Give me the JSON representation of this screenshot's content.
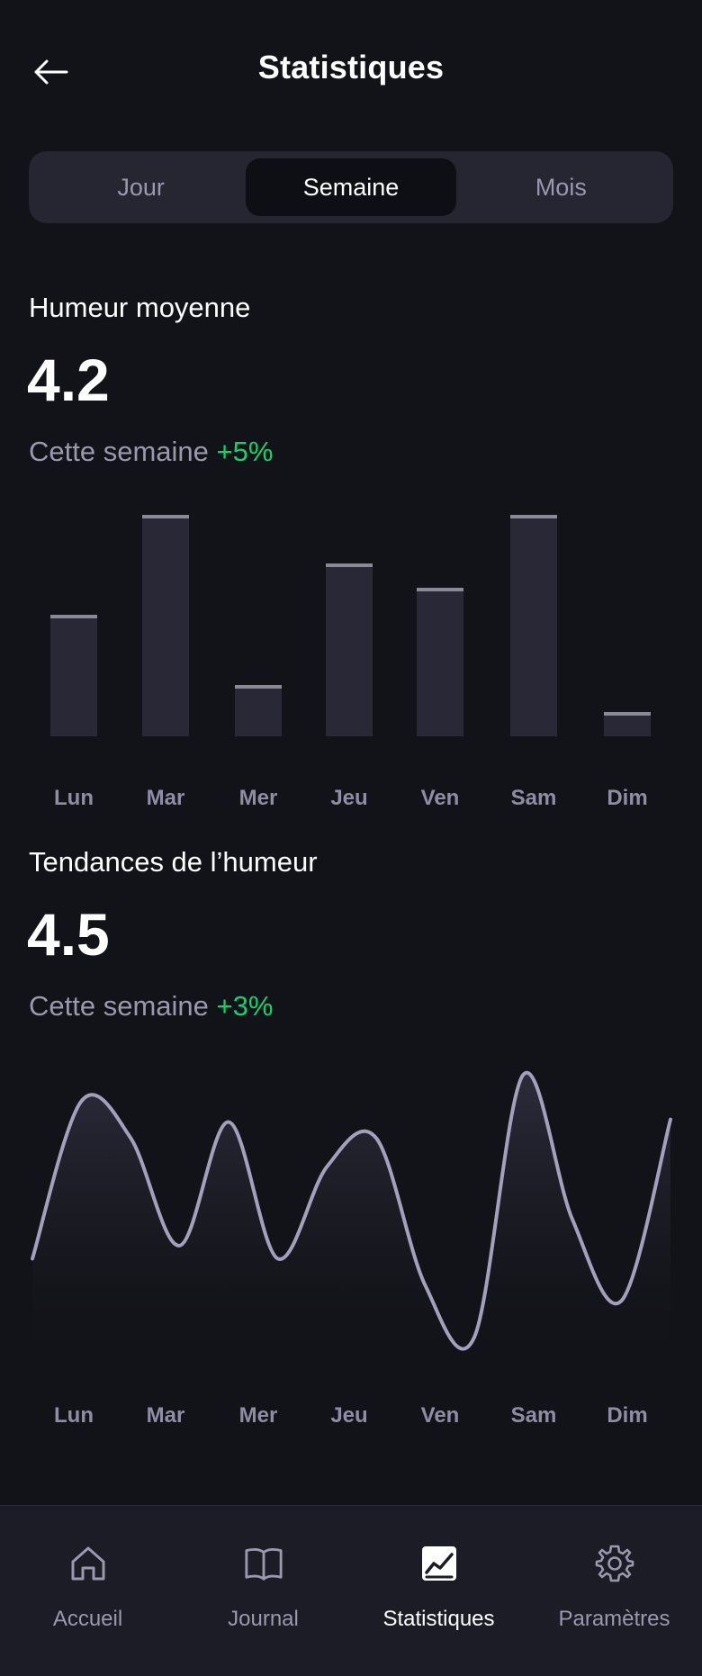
{
  "header": {
    "title": "Statistiques"
  },
  "tabs": [
    {
      "label": "Jour"
    },
    {
      "label": "Semaine"
    },
    {
      "label": "Mois"
    }
  ],
  "mood_average": {
    "title": "Humeur moyenne",
    "value": "4.2",
    "period": "Cette semaine",
    "delta": "+5%"
  },
  "mood_trend": {
    "title": "Tendances de l’humeur",
    "value": "4.5",
    "period": "Cette semaine",
    "delta": "+3%"
  },
  "colors": {
    "background": "#121318",
    "bar": "#282836",
    "bar_cap": "#8a8a96",
    "line": "#a39fbc",
    "positive": "#12d26a",
    "muted": "#9a98ae"
  },
  "chart_data": [
    {
      "type": "bar",
      "categories": [
        "Lun",
        "Mar",
        "Mer",
        "Jeu",
        "Ven",
        "Sam",
        "Dim"
      ],
      "values": [
        4.5,
        8.2,
        1.9,
        6.4,
        5.5,
        8.2,
        0.9
      ],
      "ylim": [
        0,
        8.2
      ],
      "grid": false
    },
    {
      "type": "line",
      "categories": [
        "Lun",
        "Mar",
        "Mer",
        "Jeu",
        "Ven",
        "Sam",
        "Dim"
      ],
      "area": true,
      "grid": false,
      "x": [
        0,
        0.5,
        1,
        1.5,
        2,
        2.5,
        3,
        3.5,
        4,
        4.5,
        5,
        5.5,
        6,
        6.5
      ],
      "values": [
        3.0,
        9.0,
        7.6,
        3.5,
        8.2,
        3.0,
        6.5,
        7.6,
        2.0,
        0.0,
        10.0,
        4.5,
        1.4,
        8.3
      ],
      "ylim": [
        0,
        10
      ]
    }
  ],
  "nav": [
    {
      "label": "Accueil",
      "icon": "home-icon"
    },
    {
      "label": "Journal",
      "icon": "book-icon"
    },
    {
      "label": "Statistiques",
      "icon": "chart-icon"
    },
    {
      "label": "Paramètres",
      "icon": "gear-icon"
    }
  ]
}
